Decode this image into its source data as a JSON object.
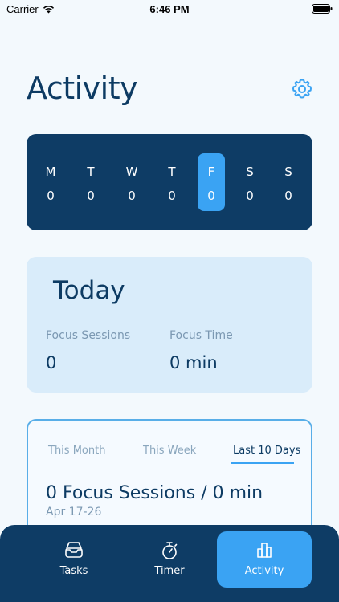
{
  "status": {
    "carrier": "Carrier",
    "time": "6:46 PM"
  },
  "header": {
    "title": "Activity"
  },
  "week": {
    "days": [
      {
        "letter": "M",
        "count": "0",
        "active": false
      },
      {
        "letter": "T",
        "count": "0",
        "active": false
      },
      {
        "letter": "W",
        "count": "0",
        "active": false
      },
      {
        "letter": "T",
        "count": "0",
        "active": false
      },
      {
        "letter": "F",
        "count": "0",
        "active": true
      },
      {
        "letter": "S",
        "count": "0",
        "active": false
      },
      {
        "letter": "S",
        "count": "0",
        "active": false
      }
    ]
  },
  "today": {
    "title": "Today",
    "sessions_label": "Focus Sessions",
    "sessions_value": "0",
    "time_label": "Focus Time",
    "time_value": "0 min"
  },
  "summary": {
    "tabs": [
      "This Month",
      "This Week",
      "Last 10 Days"
    ],
    "active_tab": "Last 10 Days",
    "headline": "0 Focus Sessions / 0 min",
    "range": "Apr 17-26"
  },
  "tabbar": {
    "items": [
      {
        "label": "Tasks",
        "icon": "inbox-tray-icon"
      },
      {
        "label": "Timer",
        "icon": "stopwatch-icon"
      },
      {
        "label": "Activity",
        "icon": "bar-chart-icon"
      }
    ],
    "active": "Activity"
  },
  "colors": {
    "navy": "#0e3c65",
    "accent": "#3aa3f3",
    "light_card": "#d9ecfa",
    "background": "#f3f9fd"
  }
}
